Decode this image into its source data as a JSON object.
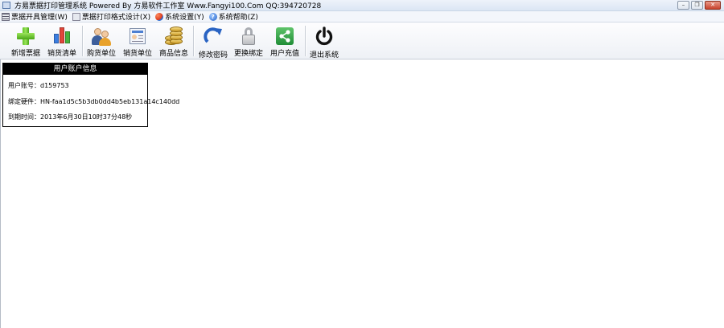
{
  "window": {
    "title": "方易票据打印管理系统 Powered By 方易软件工作室 Www.Fangyi100.Com QQ:394720728",
    "controls": {
      "minimize": "–",
      "restore": "❐",
      "close": "✕"
    }
  },
  "menu": [
    {
      "label": "票据开具管理(W)",
      "icon": "list-icon"
    },
    {
      "label": "票据打印格式设计(X)",
      "icon": "print-design-icon"
    },
    {
      "label": "系统设置(Y)",
      "icon": "settings-icon"
    },
    {
      "label": "系统帮助(Z)",
      "icon": "help-icon"
    }
  ],
  "toolbar": [
    {
      "label": "新增票据",
      "icon": "add-plus-icon"
    },
    {
      "label": "销货清单",
      "icon": "bar-chart-icon"
    },
    {
      "label": "购货单位",
      "icon": "buyer-people-icon"
    },
    {
      "label": "销货单位",
      "icon": "seller-card-icon"
    },
    {
      "label": "商品信息",
      "icon": "coins-icon"
    },
    {
      "label": "修改密码",
      "icon": "refresh-arrow-icon"
    },
    {
      "label": "更换绑定",
      "icon": "lock-icon"
    },
    {
      "label": "用户充值",
      "icon": "share-icon"
    },
    {
      "label": "退出系统",
      "icon": "power-icon"
    }
  ],
  "account_panel": {
    "title": "用户账户信息",
    "rows": [
      {
        "label": "用户账号：",
        "value": "d159753"
      },
      {
        "label": "绑定硬件：",
        "value": "HN-faa1d5c5b3db0dd4b5eb131a14c140dd"
      },
      {
        "label": "到期时间：",
        "value": "2013年6月30日10时37分48秒"
      }
    ]
  },
  "colors": {
    "menu_bg": "#f3f6fb",
    "panel_header_bg": "#000000",
    "accent_blue": "#2f6bd0",
    "accent_green": "#4aa617"
  }
}
